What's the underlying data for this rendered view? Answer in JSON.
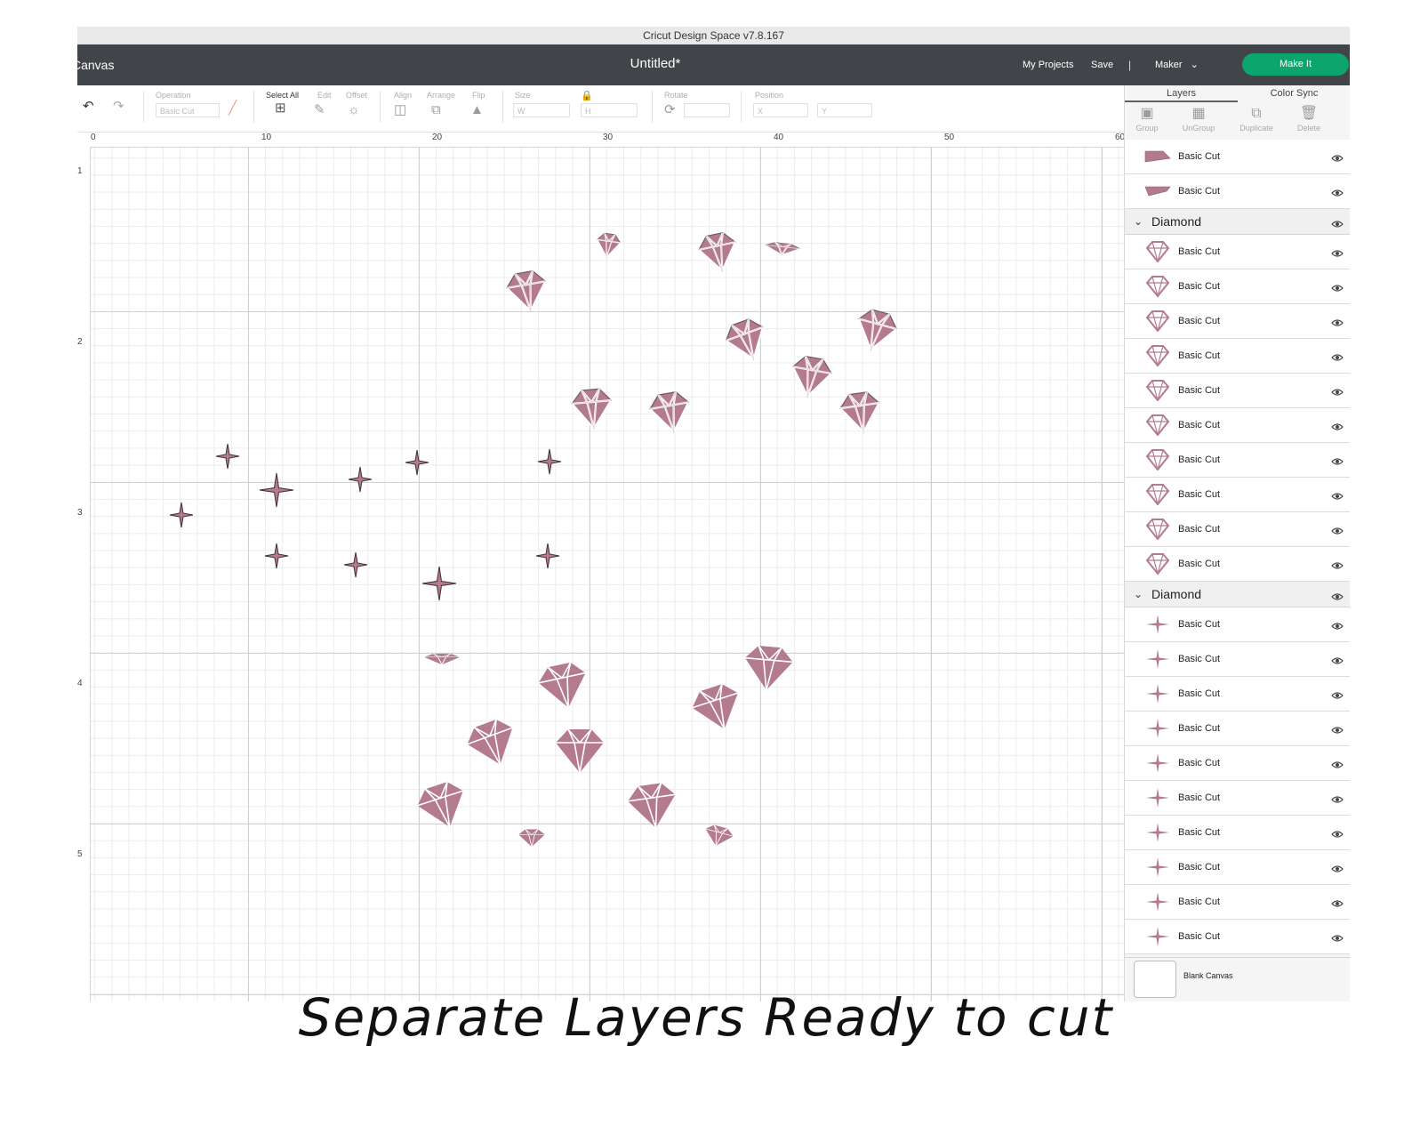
{
  "window": {
    "title": "Cricut Design Space  v7.8.167"
  },
  "header": {
    "left_title": "Canvas",
    "doc_title": "Untitled*",
    "my_projects": "My Projects",
    "save": "Save",
    "separator": "|",
    "machine": "Maker",
    "make_it": "Make It"
  },
  "toolbar": {
    "operation_label": "Operation",
    "operation_value": "Basic Cut",
    "select_all": "Select All",
    "edit": "Edit",
    "offset": "Offset",
    "align": "Align",
    "arrange": "Arrange",
    "flip": "Flip",
    "size": "Size",
    "w": "W",
    "h": "H",
    "rotate": "Rotate",
    "position": "Position",
    "x": "X",
    "y": "Y"
  },
  "ruler": {
    "top": [
      "0",
      "10",
      "20",
      "30",
      "40",
      "50",
      "60"
    ],
    "left": [
      "1",
      "2",
      "3",
      "4",
      "5"
    ]
  },
  "panel": {
    "tabs": [
      "Layers",
      "Color Sync"
    ],
    "tools": [
      "Group",
      "UnGroup",
      "Duplicate",
      "Delete"
    ],
    "top_layers": [
      "Basic Cut",
      "Basic Cut"
    ],
    "groups": [
      {
        "name": "Diamond",
        "layers": [
          "Basic Cut",
          "Basic Cut",
          "Basic Cut",
          "Basic Cut",
          "Basic Cut",
          "Basic Cut",
          "Basic Cut",
          "Basic Cut",
          "Basic Cut",
          "Basic Cut"
        ]
      },
      {
        "name": "Diamond",
        "layers": [
          "Basic Cut",
          "Basic Cut",
          "Basic Cut",
          "Basic Cut",
          "Basic Cut",
          "Basic Cut",
          "Basic Cut",
          "Basic Cut",
          "Basic Cut",
          "Basic Cut"
        ]
      }
    ],
    "blank_canvas": "Blank Canvas"
  },
  "colors": {
    "shape": "#b47a8e",
    "header": "#414449",
    "make_it": "#0ca56d"
  },
  "caption": "Separate Layers Ready to cut"
}
